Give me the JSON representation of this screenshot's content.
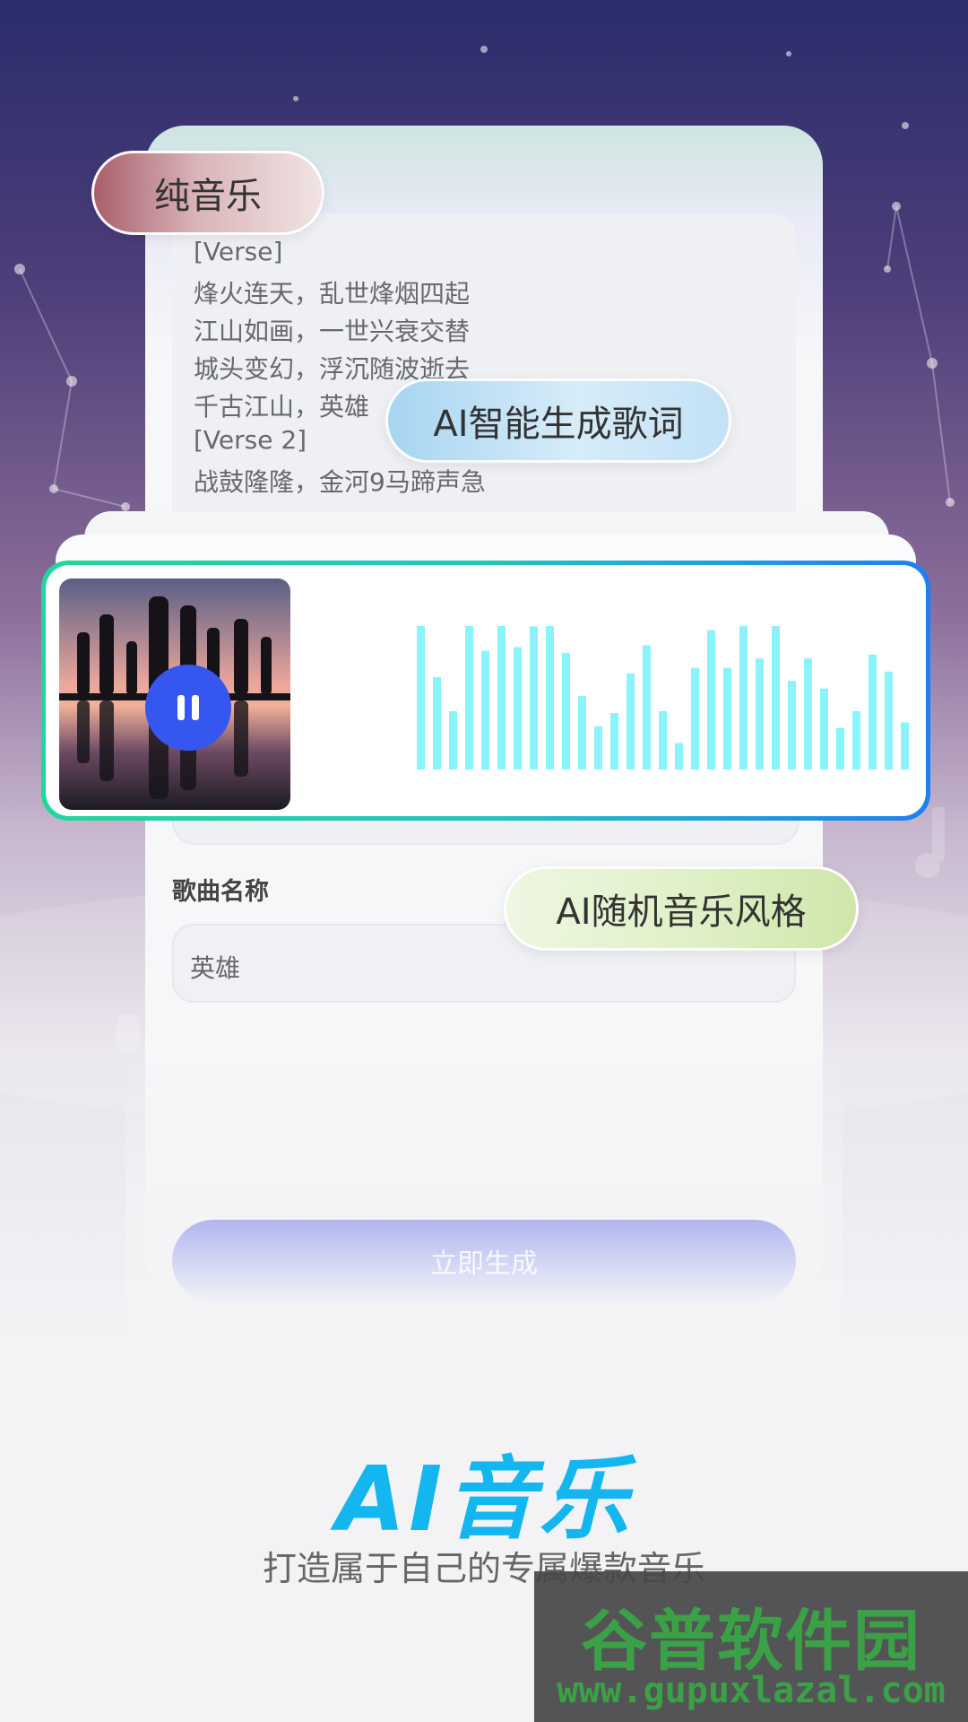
{
  "pills": {
    "pure_music": "纯音乐",
    "ai_lyrics": "AI智能生成歌词",
    "ai_style": "AI随机音乐风格"
  },
  "lyrics": [
    "[Verse]",
    "烽火连天，乱世烽烟四起",
    "江山如画，一世兴衰交替",
    "城头变幻，浮沉随波逝去",
    "千古江山，英雄",
    "[Verse 2]",
    "战鼓隆隆，金河9马蹄声急"
  ],
  "player": {
    "state": "playing",
    "control_icon": "pause-icon",
    "waveform_levels": [
      0.78,
      0.49,
      0.31,
      0.78,
      0.63,
      0.78,
      0.65,
      0.76,
      0.78,
      0.62,
      0.39,
      0.23,
      0.3,
      0.51,
      0.66,
      0.31,
      0.14,
      0.54,
      0.74,
      0.54,
      0.78,
      0.59,
      0.78,
      0.47,
      0.59,
      0.43,
      0.22,
      0.31,
      0.61,
      0.52,
      0.25
    ]
  },
  "song": {
    "label": "歌曲名称",
    "value": "英雄"
  },
  "generate_button": "立即生成",
  "hero": {
    "title": "AI音乐",
    "subtitle": "打造属于自己的专属爆款音乐"
  },
  "watermark": {
    "name": "谷普软件园",
    "url": "www.gupuxlazal.com"
  },
  "colors": {
    "accent": "#14b6f0",
    "pause_button": "#3657ef",
    "waveform": "#8af3fb",
    "border_start": "#1fd79a",
    "border_end": "#1d7ff2"
  }
}
